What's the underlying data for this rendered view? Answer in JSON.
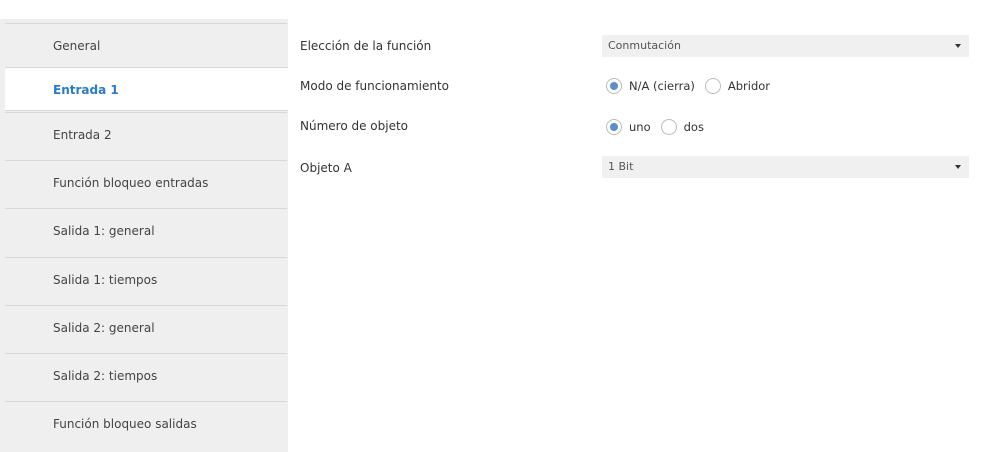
{
  "sidebar": {
    "items": [
      {
        "label": "General",
        "active": false
      },
      {
        "label": "Entrada 1",
        "active": true
      },
      {
        "label": "Entrada 2",
        "active": false
      },
      {
        "label": "Función bloqueo entradas",
        "active": false
      },
      {
        "label": "Salida 1: general",
        "active": false
      },
      {
        "label": "Salida 1: tiempos",
        "active": false
      },
      {
        "label": "Salida 2: general",
        "active": false
      },
      {
        "label": "Salida 2: tiempos",
        "active": false
      },
      {
        "label": "Función bloqueo salidas",
        "active": false
      }
    ]
  },
  "params": {
    "funcion": {
      "label": "Elección de la función",
      "value": "Conmutación"
    },
    "modo": {
      "label": "Modo de funcionamiento",
      "options": [
        {
          "label": "N/A (cierra)",
          "selected": true
        },
        {
          "label": "Abridor",
          "selected": false
        }
      ]
    },
    "numero": {
      "label": "Número de objeto",
      "options": [
        {
          "label": "uno",
          "selected": true
        },
        {
          "label": "dos",
          "selected": false
        }
      ]
    },
    "objeto": {
      "label": "Objeto A",
      "value": "1 Bit"
    }
  },
  "colors": {
    "accent": "#2a7cc8",
    "radio_selected": "#5c8fc8",
    "sidebar_bg": "#efefef"
  }
}
